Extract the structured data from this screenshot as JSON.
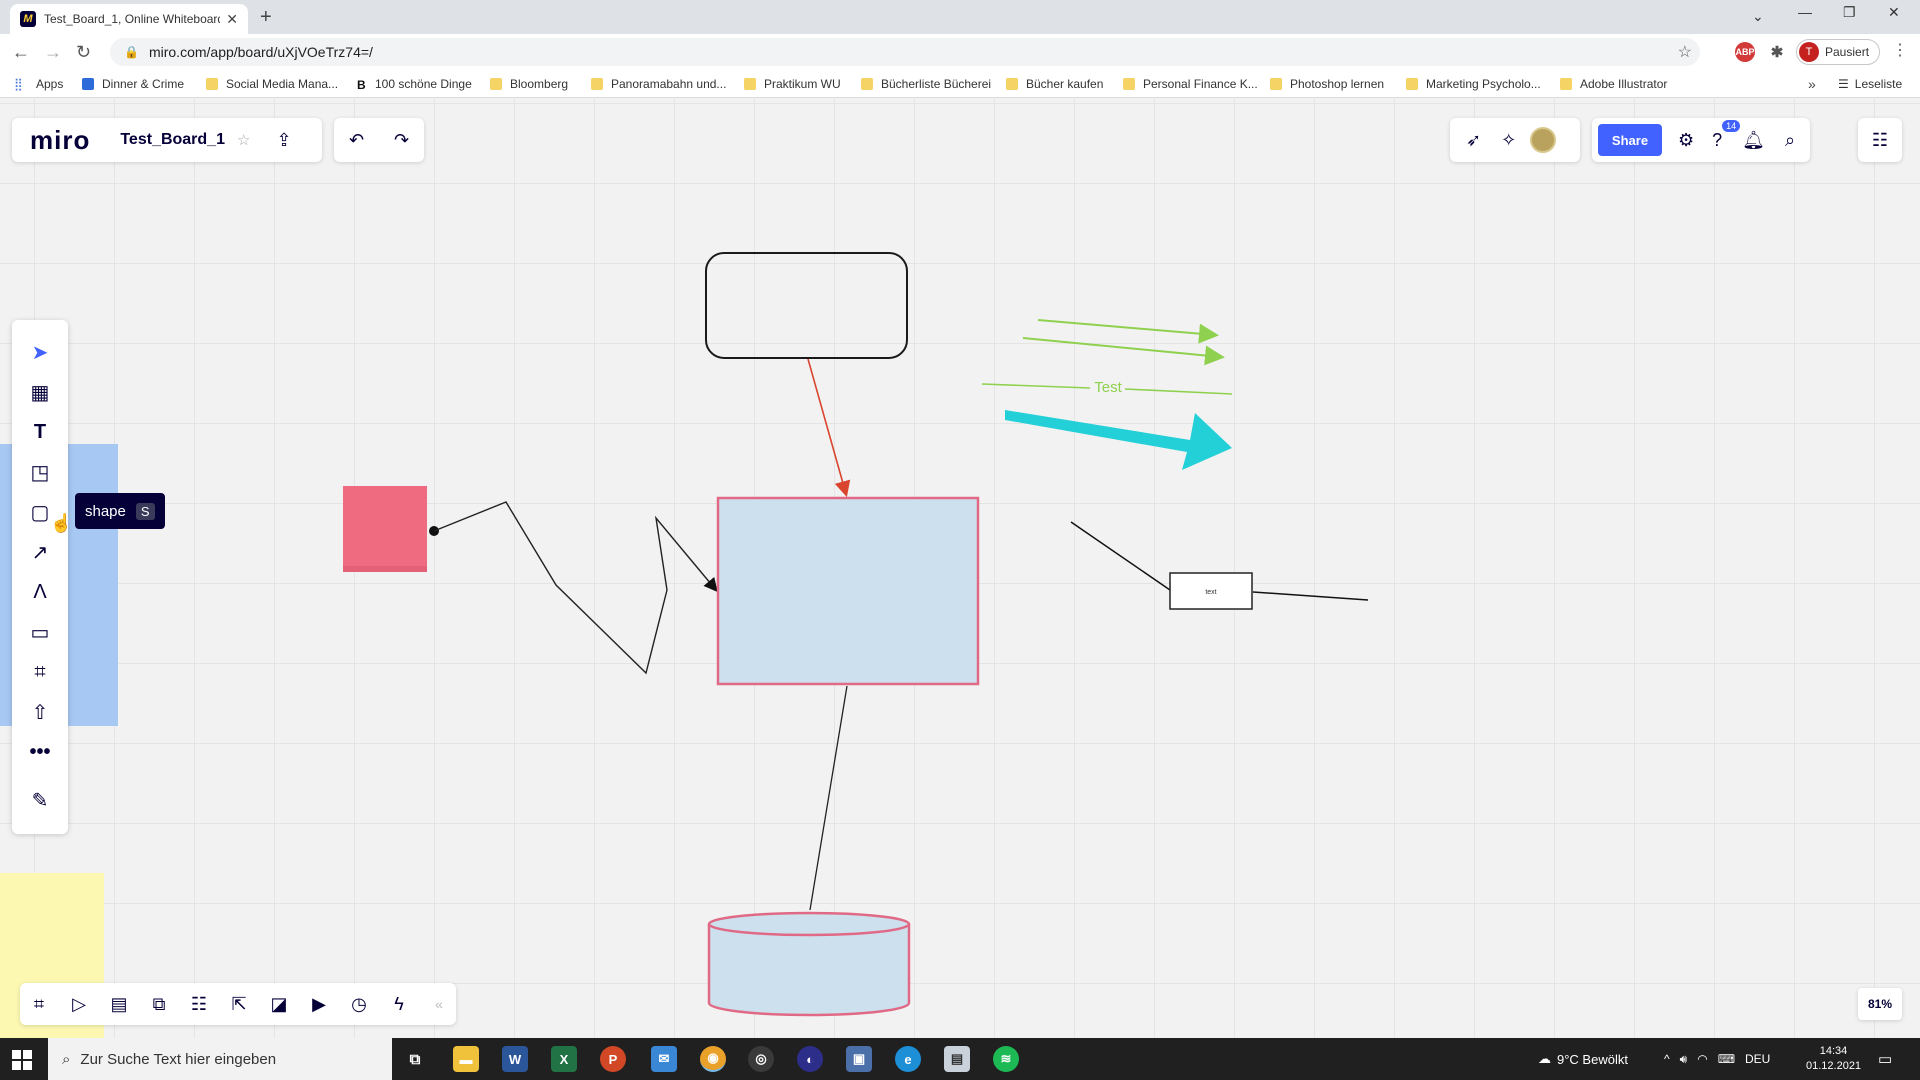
{
  "browser": {
    "tab_title": "Test_Board_1, Online Whiteboard f",
    "url": "miro.com/app/board/uXjVOeTrz74=/",
    "profile_label": "Pausiert",
    "profile_initial": "T",
    "bookmarks": [
      "Apps",
      "Dinner & Crime",
      "Social Media Mana...",
      "100 schöne Dinge",
      "Bloomberg",
      "Panoramabahn und...",
      "Praktikum WU",
      "Bücherliste Bücherei",
      "Bücher kaufen",
      "Personal Finance K...",
      "Photoshop lernen",
      "Marketing Psycholo...",
      "Adobe Illustrator"
    ],
    "reading_list": "Leseliste"
  },
  "miro": {
    "logo": "miro",
    "board_name": "Test_Board_1",
    "share_label": "Share",
    "help_badge": "14",
    "zoom": "81%",
    "tooltip": {
      "label": "shape",
      "key": "S"
    }
  },
  "board": {
    "small_box_label": "text",
    "green_line_label": "Test",
    "colors": {
      "sticky_pink": "#ef6b80",
      "light_blue": "#cde0ee",
      "pink_border": "#e06a86",
      "red_arrow": "#d9452f",
      "green": "#8fd14f",
      "cyan": "#23d0d8",
      "side_blue": "#a7c8f2",
      "yellow": "#fcf8b2"
    }
  },
  "taskbar": {
    "search_placeholder": "Zur Suche Text hier eingeben",
    "weather": "9°C  Bewölkt",
    "language": "DEU",
    "time": "14:34",
    "date": "01.12.2021"
  }
}
